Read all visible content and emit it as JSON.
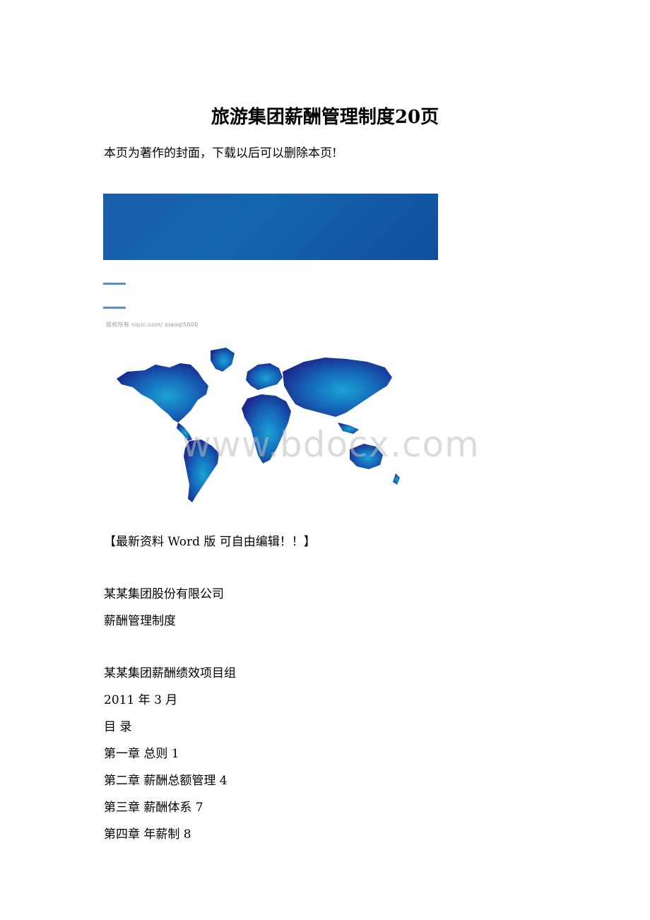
{
  "document": {
    "title": "旅游集团薪酬管理制度20页",
    "cover_note": "本页为著作的封面，下载以后可以删除本页!",
    "image_caption": "版权所有 nipic.com/ xiaoqi5000",
    "watermark": "www.bdocx.com",
    "edit_note": "【最新资料 Word 版 可自由编辑！！】",
    "company": "某某集团股份有限公司",
    "subtitle": "薪酬管理制度",
    "project_group": "某某集团薪酬绩效项目组",
    "date": "2011 年 3 月",
    "toc_heading": "目 录",
    "toc": [
      "第一章 总则 1",
      "第二章 薪酬总额管理 4",
      "第三章 薪酬体系 7",
      "第四章 年薪制 8"
    ]
  },
  "colors": {
    "banner": "#1566b0",
    "dash": "#5b8fc4",
    "map_dark": "#1a2a8c",
    "map_light": "#1aa3d4"
  }
}
